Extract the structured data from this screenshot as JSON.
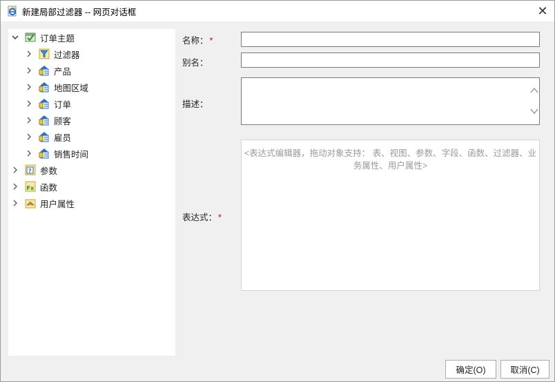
{
  "window": {
    "title": "新建局部过滤器 -- 网页对话框",
    "close_glyph": "✕"
  },
  "tree": {
    "items": [
      {
        "label": "订单主题",
        "icon": "subject-check-icon",
        "expanded": true,
        "level": 0
      },
      {
        "label": "过滤器",
        "icon": "filter-icon",
        "expanded": false,
        "level": 1
      },
      {
        "label": "产品",
        "icon": "table-icon",
        "expanded": false,
        "level": 1
      },
      {
        "label": "地图区域",
        "icon": "table-icon",
        "expanded": false,
        "level": 1
      },
      {
        "label": "订单",
        "icon": "table-icon",
        "expanded": false,
        "level": 1
      },
      {
        "label": "顾客",
        "icon": "table-icon",
        "expanded": false,
        "level": 1
      },
      {
        "label": "雇员",
        "icon": "table-icon",
        "expanded": false,
        "level": 1
      },
      {
        "label": "销售时间",
        "icon": "table-icon",
        "expanded": false,
        "level": 1
      },
      {
        "label": "参数",
        "icon": "parameter-icon",
        "expanded": false,
        "level": 0
      },
      {
        "label": "函数",
        "icon": "function-icon",
        "expanded": false,
        "level": 0
      },
      {
        "label": "用户属性",
        "icon": "user-attribute-icon",
        "expanded": false,
        "level": 0
      }
    ]
  },
  "form": {
    "name_label": "名称：",
    "alias_label": "别名：",
    "desc_label": "描述：",
    "expr_label": "表达式：",
    "required_mark": "*",
    "name_value": "",
    "alias_value": "",
    "desc_value": "",
    "expr_placeholder": "<表达式编辑器，拖动对象支持： 表、视图、参数、字段、函数、过滤器、业务属性、用户属性>"
  },
  "buttons": {
    "ok": "确定(O)",
    "cancel": "取消(C)"
  },
  "colors": {
    "required": "#d40000",
    "background": "#f0f0f0",
    "icon_blue": "#2f6fbf",
    "icon_yellow": "#e8c84a"
  }
}
